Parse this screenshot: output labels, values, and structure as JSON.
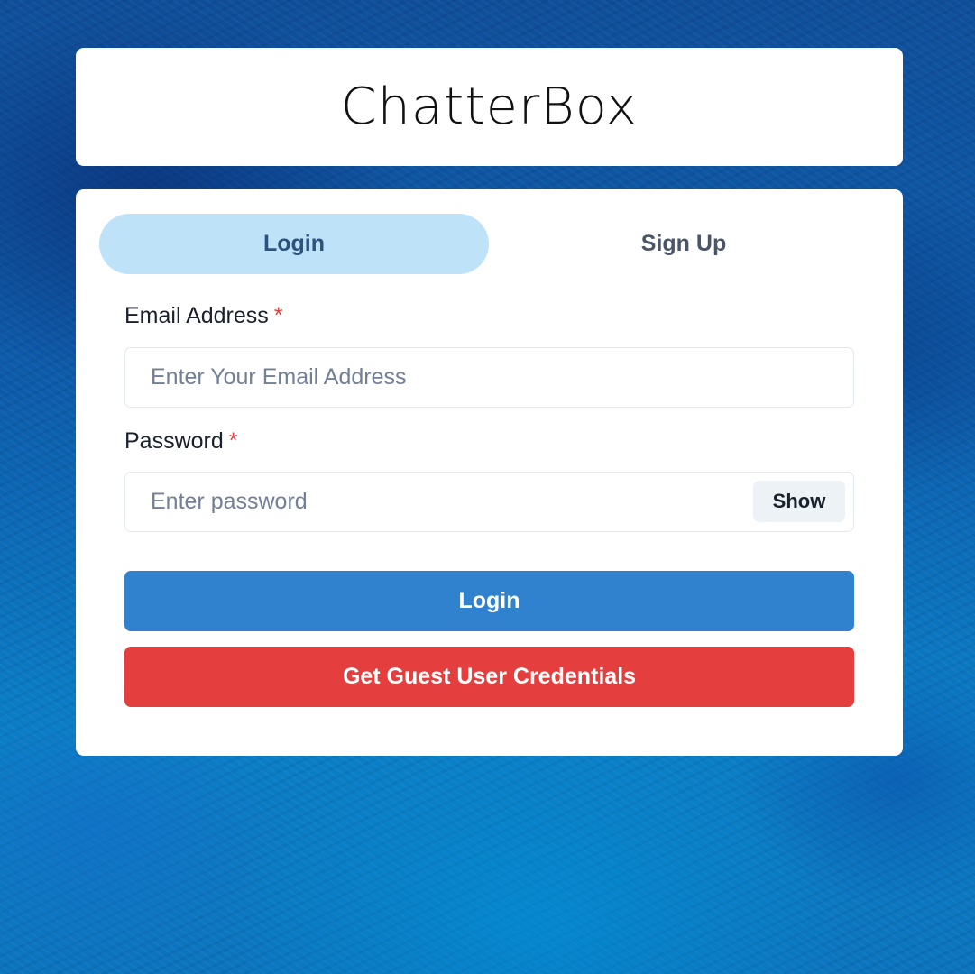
{
  "app": {
    "title": "ChatterBox"
  },
  "tabs": [
    {
      "label": "Login",
      "active": true
    },
    {
      "label": "Sign Up",
      "active": false
    }
  ],
  "form": {
    "email": {
      "label": "Email Address",
      "required_marker": "*",
      "placeholder": "Enter Your Email Address",
      "value": ""
    },
    "password": {
      "label": "Password",
      "required_marker": "*",
      "placeholder": "Enter password",
      "value": "",
      "toggle_label": "Show"
    },
    "submit_label": "Login",
    "guest_label": "Get Guest User Credentials"
  },
  "colors": {
    "active_tab_bg": "#bee3f8",
    "active_tab_text": "#2c5282",
    "login_button": "#3182ce",
    "guest_button": "#e53e3e",
    "required_star": "#e53e3e"
  }
}
